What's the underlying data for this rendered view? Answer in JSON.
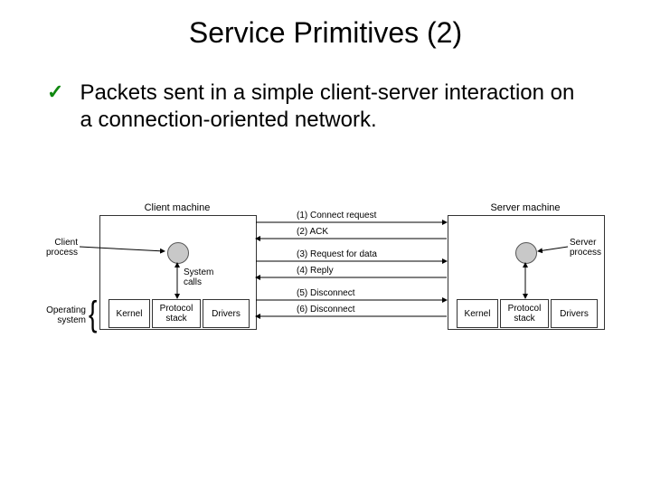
{
  "title": "Service Primitives (2)",
  "bullet": "Packets sent in a simple client-server interaction on a connection-oriented network.",
  "diagram": {
    "client_machine": "Client machine",
    "server_machine": "Server machine",
    "client_process": "Client\nprocess",
    "server_process": "Server\nprocess",
    "system_calls": "System\ncalls",
    "kernel": "Kernel",
    "protocol_stack": "Protocol\nstack",
    "drivers": "Drivers",
    "operating_system": "Operating\nsystem",
    "messages": {
      "m1": "(1) Connect request",
      "m2": "(2) ACK",
      "m3": "(3) Request for data",
      "m4": "(4) Reply",
      "m5": "(5) Disconnect",
      "m6": "(6) Disconnect"
    }
  }
}
